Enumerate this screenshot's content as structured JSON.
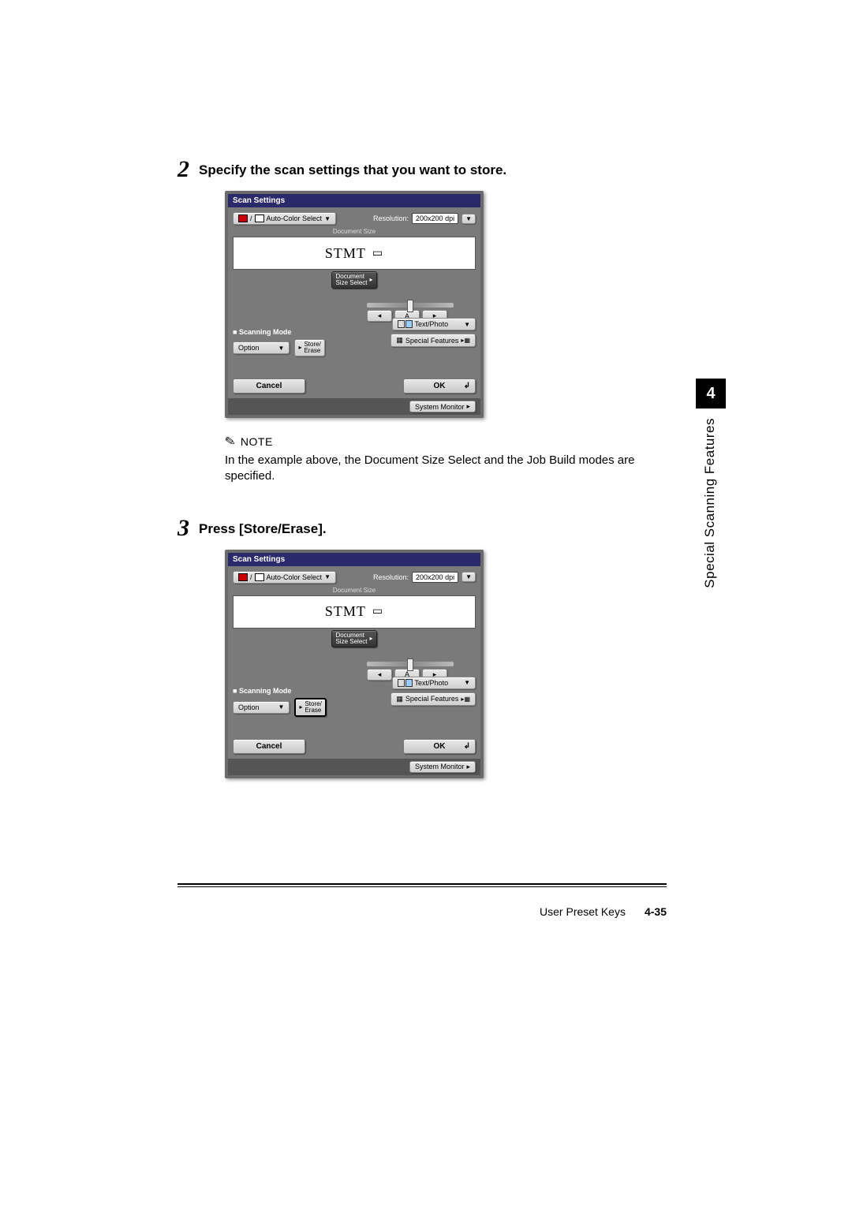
{
  "steps": {
    "s2": {
      "num": "2",
      "title": "Specify the scan settings that you want to store."
    },
    "s3": {
      "num": "3",
      "title": "Press [Store/Erase]."
    }
  },
  "note": {
    "label": "NOTE",
    "text": "In the example above, the Document Size Select and the Job Build modes are specified."
  },
  "screenshot": {
    "title": "Scan Settings",
    "color_select": "Auto-Color Select",
    "resolution_label": "Resolution:",
    "resolution_value": "200x200 dpi",
    "doc_size_label": "Document Size",
    "doc_size_value": "STMT",
    "doc_size_btn": "Document\nSize Select",
    "slider_center": "A",
    "scanning_mode_label": "Scanning Mode",
    "option": "Option",
    "store_erase": "Store/\nErase",
    "text_photo": "Text/Photo",
    "special_features": "Special Features",
    "cancel": "Cancel",
    "ok": "OK",
    "system_monitor": "System Monitor"
  },
  "sidebar": {
    "chapter_num": "4",
    "chapter_title": "Special Scanning Features"
  },
  "footer": {
    "section": "User Preset Keys",
    "page": "4-35"
  }
}
